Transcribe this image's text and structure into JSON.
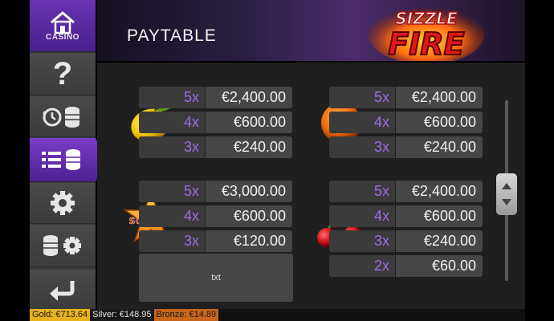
{
  "sidebar": {
    "casino_label": "CASINO"
  },
  "header": {
    "title": "PAYTABLE",
    "logo_line1": "SIZZLE",
    "logo_line2": "FIRE"
  },
  "paytable": {
    "lemon": [
      {
        "count": "5x",
        "amount": "€2,400.00"
      },
      {
        "count": "4x",
        "amount": "€600.00"
      },
      {
        "count": "3x",
        "amount": "€240.00"
      }
    ],
    "orange": [
      {
        "count": "5x",
        "amount": "€2,400.00"
      },
      {
        "count": "4x",
        "amount": "€600.00"
      },
      {
        "count": "3x",
        "amount": "€240.00"
      }
    ],
    "scatter": [
      {
        "count": "5x",
        "amount": "€3,000.00"
      },
      {
        "count": "4x",
        "amount": "€600.00"
      },
      {
        "count": "3x",
        "amount": "€120.00"
      }
    ],
    "cherry": [
      {
        "count": "5x",
        "amount": "€2,400.00"
      },
      {
        "count": "4x",
        "amount": "€600.00"
      },
      {
        "count": "3x",
        "amount": "€240.00"
      },
      {
        "count": "2x",
        "amount": "€60.00"
      }
    ],
    "scatter_symbol_text": "SCATTER",
    "txt_box": "txt"
  },
  "footer": {
    "gold": "Gold: €713.64",
    "silver": "Silver: €148.95",
    "bronze": "Bronze: €14.89"
  },
  "colors": {
    "accent_purple": "#6a33b5",
    "count_text": "#a06be0",
    "gold": "#e8b21c",
    "bronze": "#c8661c"
  }
}
